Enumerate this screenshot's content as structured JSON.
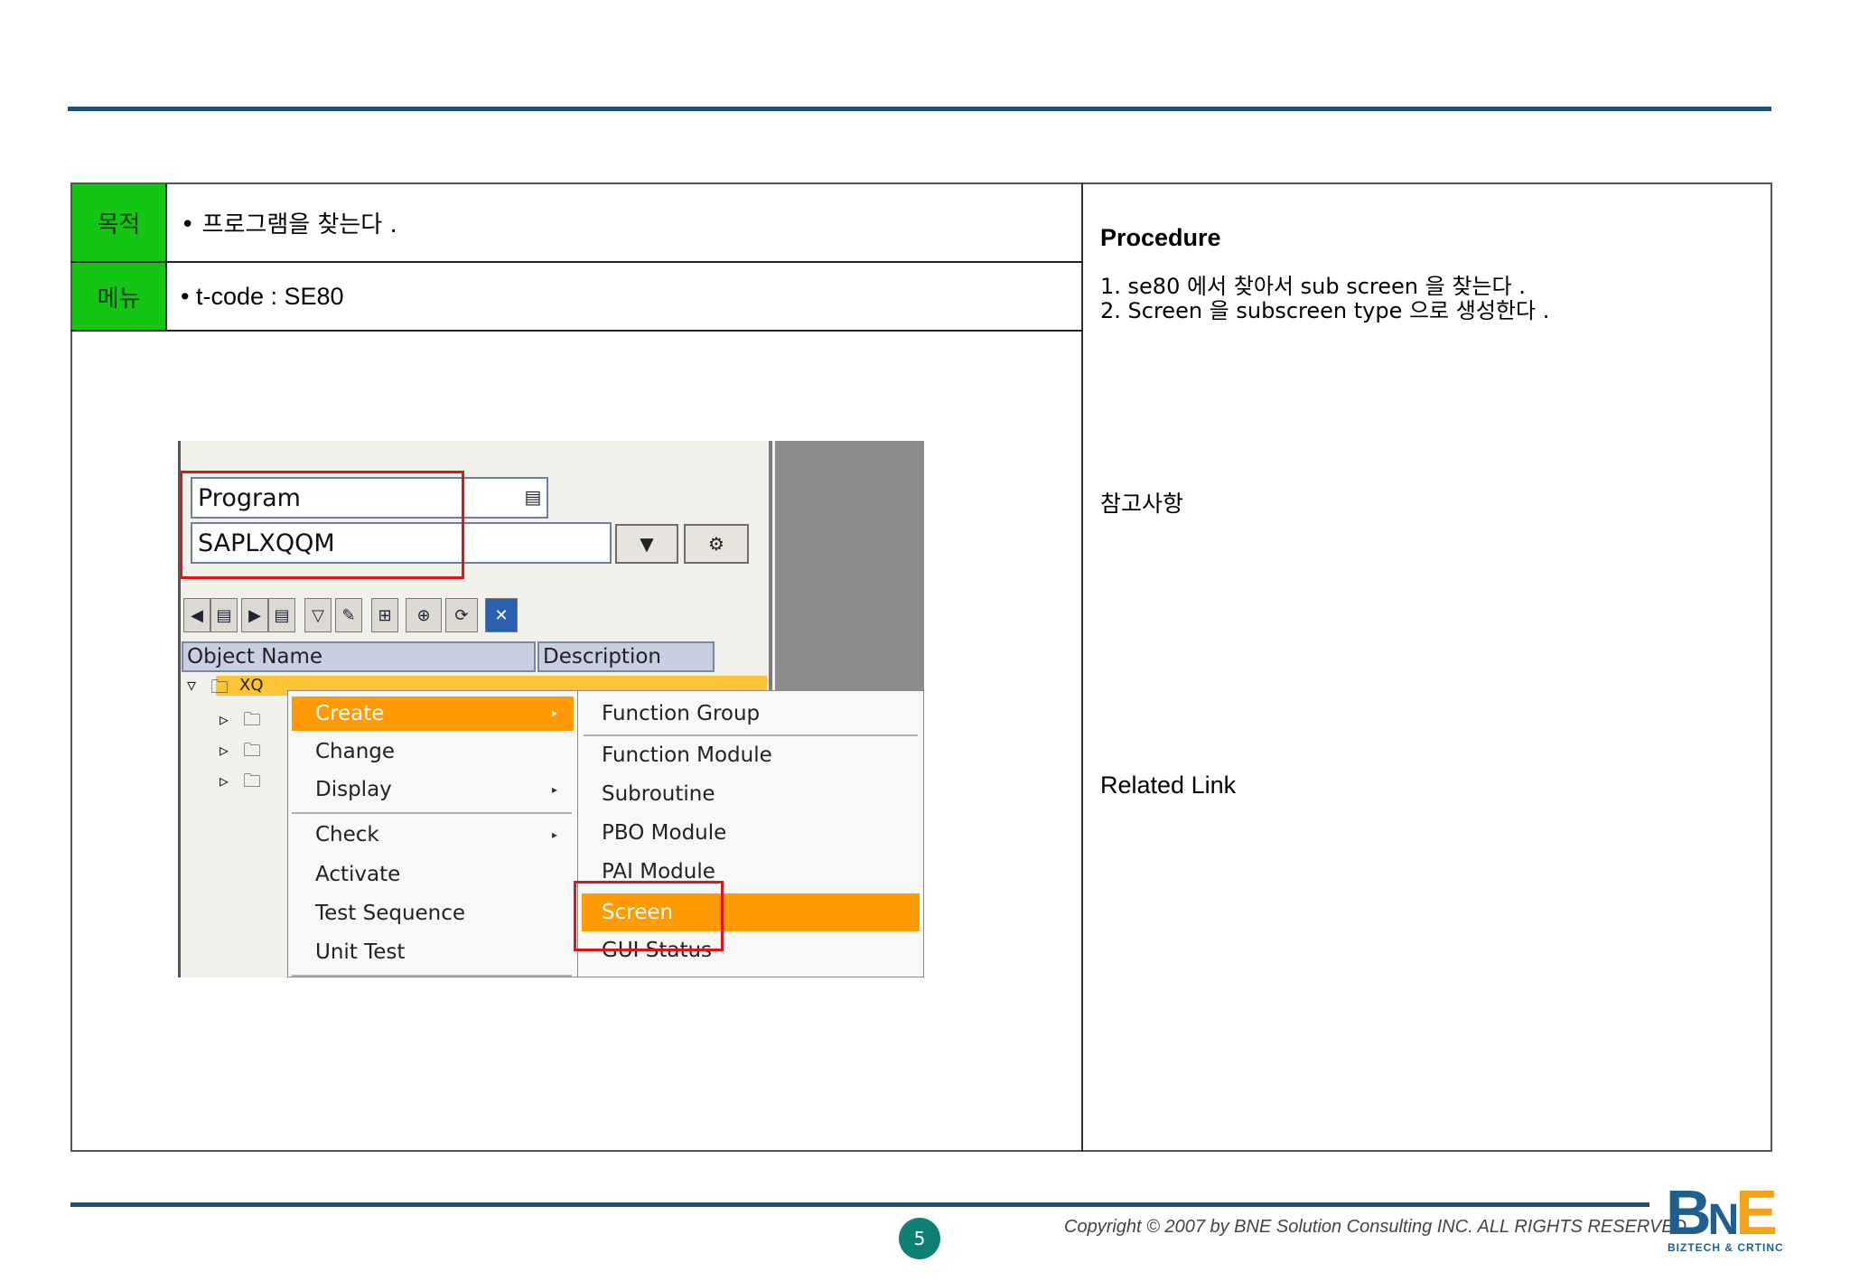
{
  "table": {
    "purpose_label": "목적",
    "purpose_text": "• 프로그램을 찾는다 .",
    "menu_label": "메뉴",
    "menu_text": "• t-code : SE80"
  },
  "right_panel": {
    "heading": "Procedure",
    "step1": "1. se80 에서 찾아서  sub screen 을 찾는다 .",
    "step2": "2. Screen 을  subscreen type 으로 생성한다 .",
    "notes_label": "참고사항",
    "related_link_label": "Related Link"
  },
  "sap_screen": {
    "object_type": "Program",
    "object_name": "SAPLXQQM",
    "col_object_name": "Object Name",
    "col_description": "Description",
    "tree_root": "XQ",
    "context_menu": [
      "Create",
      "Change",
      "Display",
      "Check",
      "Activate",
      "Test Sequence",
      "Unit Test"
    ],
    "create_submenu": [
      "Function Group",
      "Function Module",
      "Subroutine",
      "PBO Module",
      "PAI Module",
      "Screen",
      "GUI Status"
    ],
    "highlighted_menu": "Create",
    "highlighted_submenu": "Screen"
  },
  "footer": {
    "page_number": "5",
    "copyright": "Copyright © 2007 by BNE Solution Consulting INC.   ALL RIGHTS RESERVED.",
    "logo_b": "B",
    "logo_n": "N",
    "logo_e": "E",
    "logo_sub": "BIZTECH & CRTINC"
  },
  "colors": {
    "rule": "#1f4e79",
    "tag_green": "#13c613",
    "highlight_orange": "#ff9a00",
    "red_callout": "#e0141b"
  }
}
